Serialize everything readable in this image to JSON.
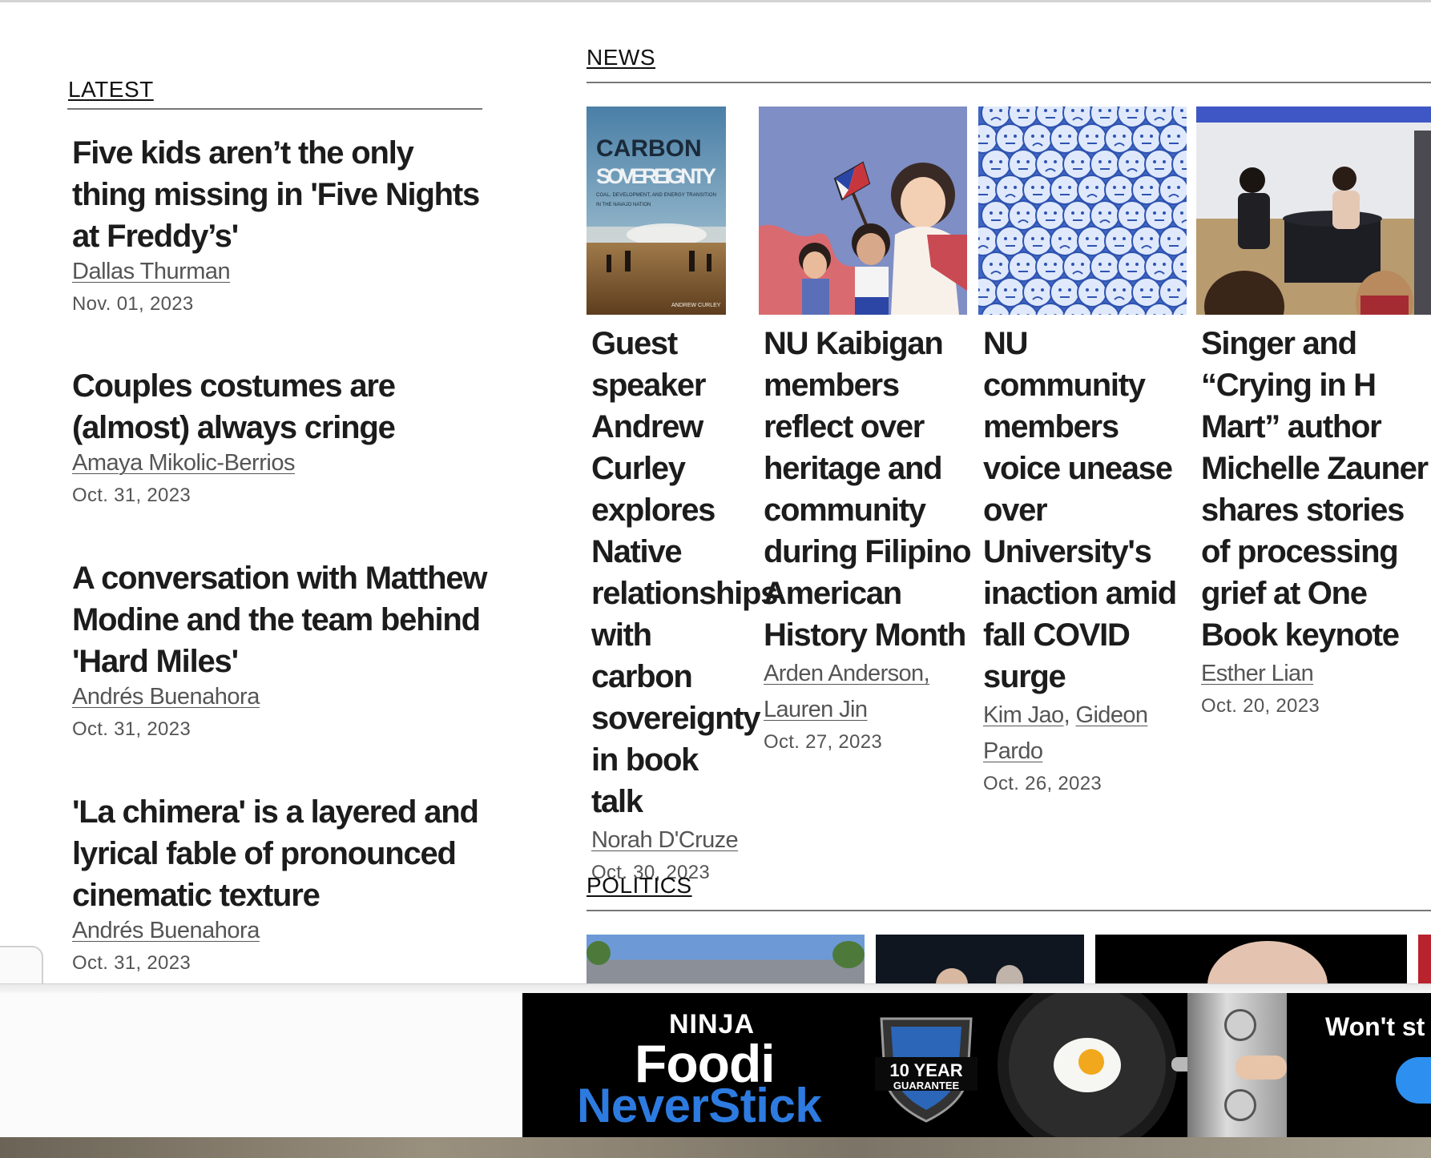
{
  "sections": {
    "latest": "LATEST",
    "news": "NEWS",
    "politics": "POLITICS"
  },
  "latest": [
    {
      "headline": "Five kids aren’t the only thing missing in 'Five Nights at Freddy’s'",
      "author": "Dallas Thurman",
      "date": "Nov. 01, 2023"
    },
    {
      "headline": "Couples costumes are (almost) always cringe",
      "author": "Amaya Mikolic-Berrios",
      "date": "Oct. 31, 2023"
    },
    {
      "headline": "A conversation with Matthew Modine and the team behind 'Hard Miles'",
      "author": "Andrés Buenahora",
      "date": "Oct. 31, 2023"
    },
    {
      "headline": "'La chimera' is a layered and lyrical fable of pronounced cinematic texture",
      "author": "Andrés Buenahora",
      "date": "Oct. 31, 2023"
    }
  ],
  "news": [
    {
      "headline": "Guest speaker Andrew Curley explores Native relationships with carbon sovereignty in book talk",
      "authors": [
        "Norah D'Cruze"
      ],
      "date": "Oct. 30, 2023",
      "image": {
        "title_line1": "CARBON",
        "title_line2": "SOVEREIGNTY",
        "subtitle_line1": "COAL, DEVELOPMENT, AND ENERGY TRANSITION",
        "subtitle_line2": "IN THE NAVAJO NATION",
        "author": "ANDREW CURLEY"
      }
    },
    {
      "headline": "NU Kaibigan members reflect over heritage and community during Filipino American History Month",
      "authors": [
        "Arden Anderson,",
        "Lauren Jin"
      ],
      "date": "Oct. 27, 2023"
    },
    {
      "headline": "NU community members voice unease over University's inaction amid fall COVID surge",
      "authors": [
        "Kim Jao",
        "Gideon Pardo"
      ],
      "author_sep": ", ",
      "date": "Oct. 26, 2023"
    },
    {
      "headline": "Singer and “Crying in H Mart” author Michelle Zauner shares stories of processing grief at One Book keynote",
      "authors": [
        "Esther Lian"
      ],
      "date": "Oct. 20, 2023"
    }
  ],
  "ad": {
    "brand_top": "NINJA",
    "brand_mid": "Foodi",
    "brand_bottom": "NeverStick",
    "badge_line1": "10 YEAR",
    "badge_line2": "GUARANTEE",
    "tagline": "Won't st",
    "colors": {
      "blue": "#2d7be0",
      "badge": "#2b66b8"
    }
  }
}
